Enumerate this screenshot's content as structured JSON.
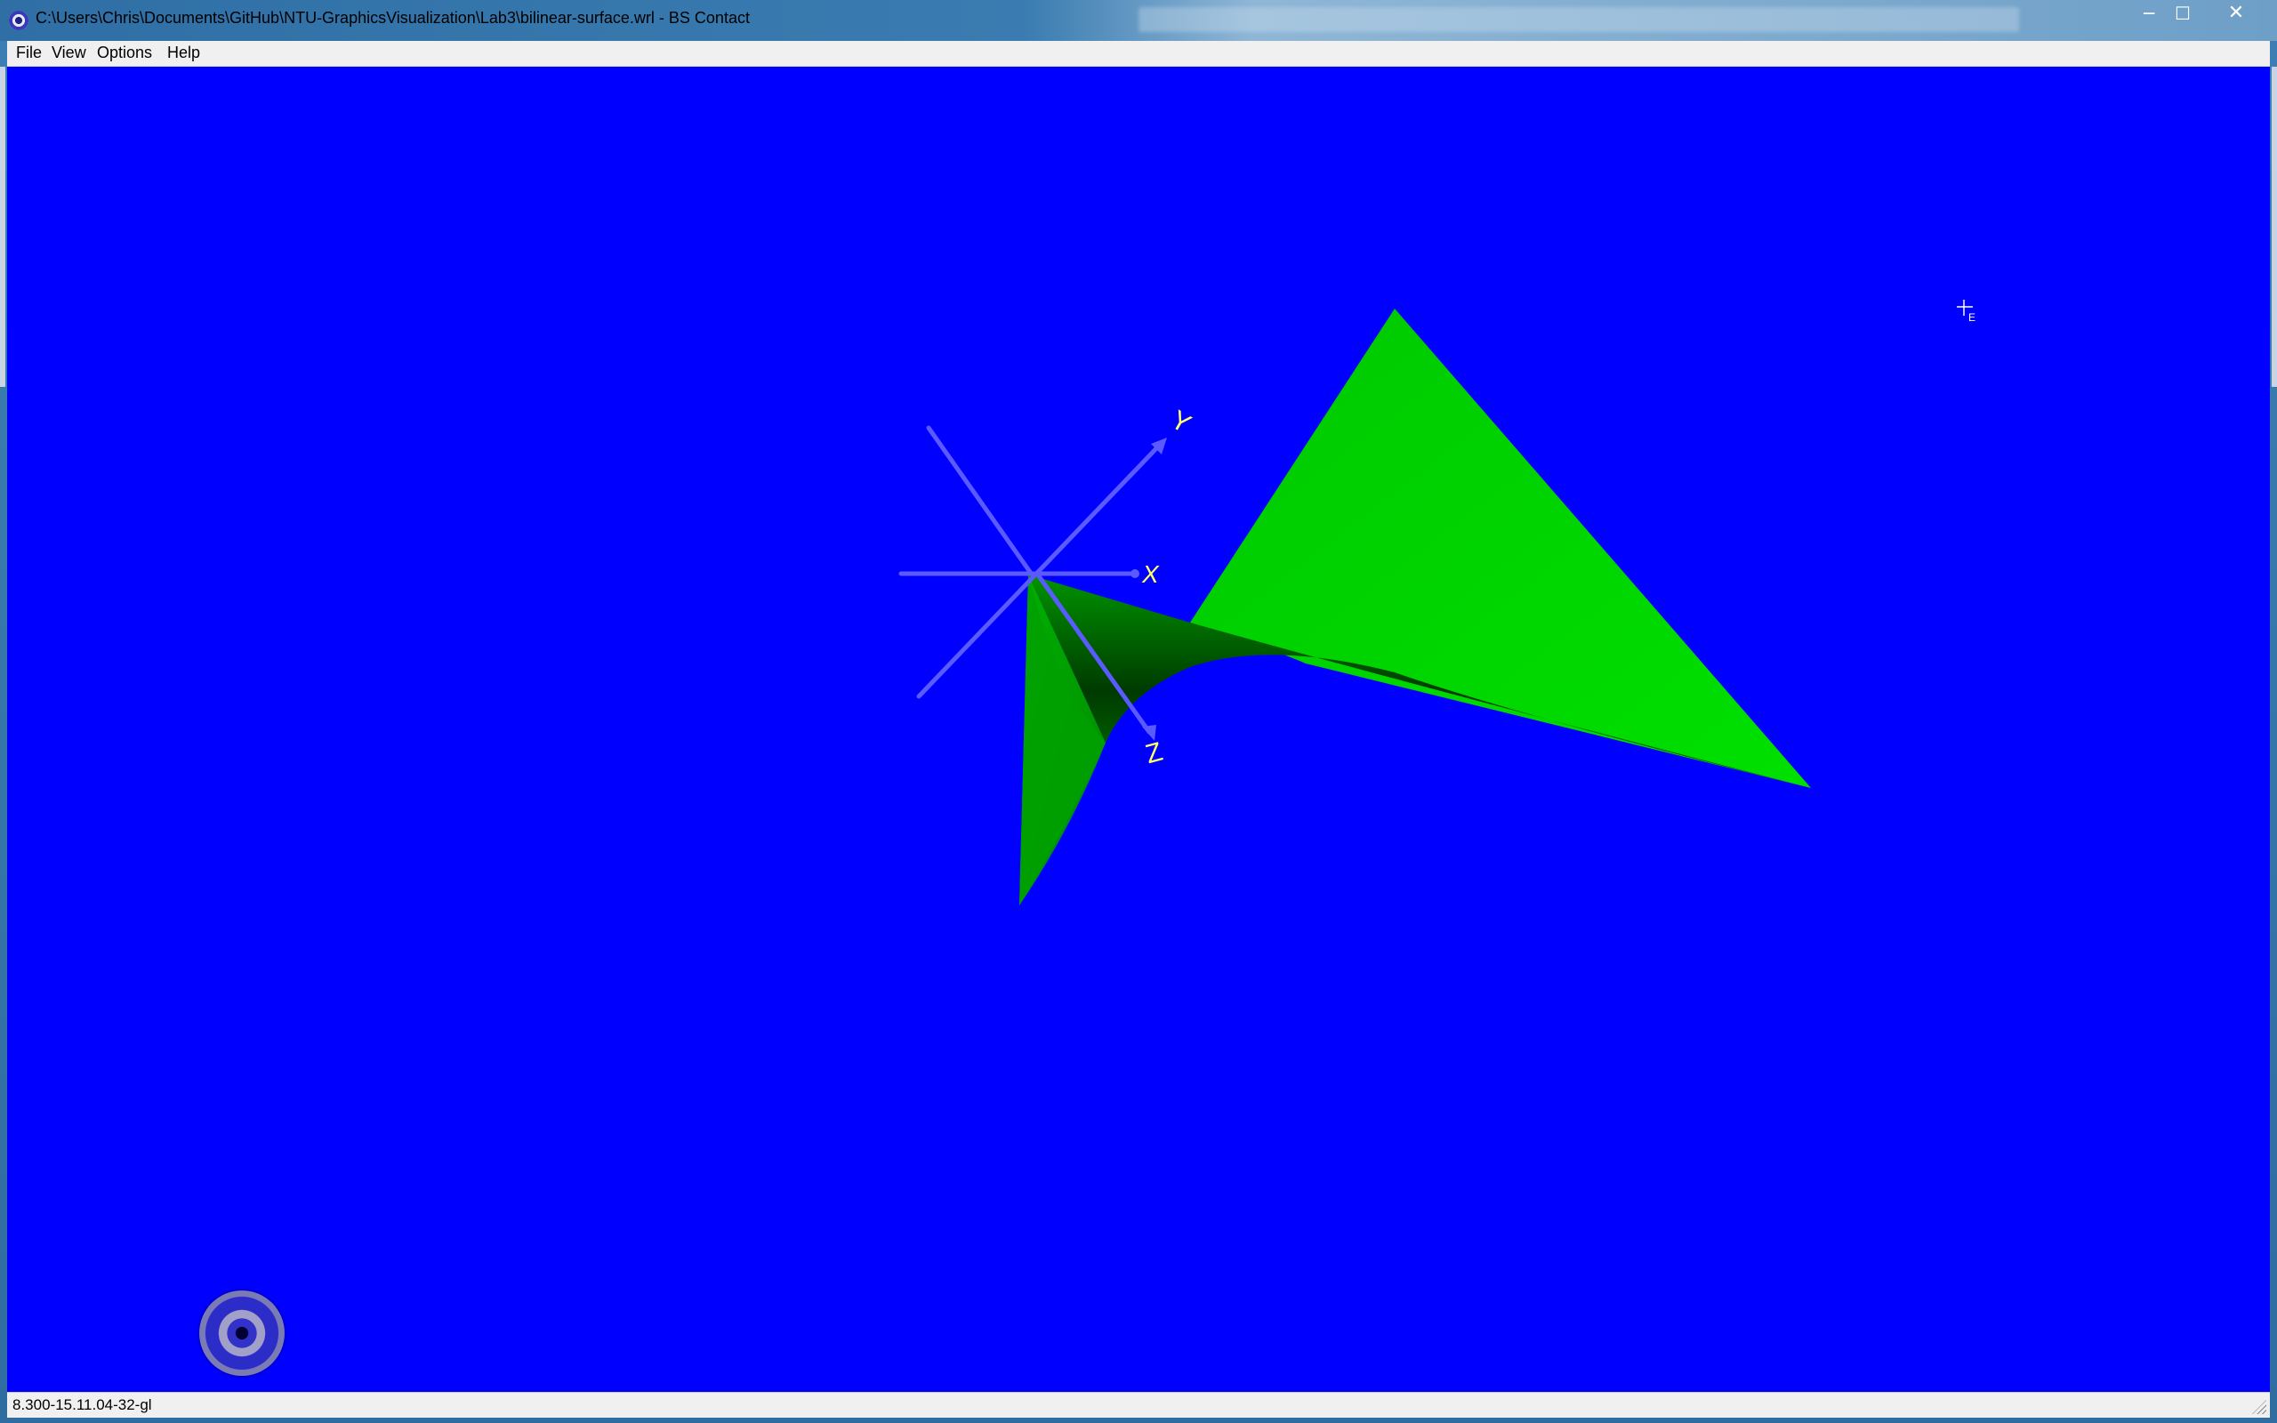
{
  "window": {
    "title": "C:\\Users\\Chris\\Documents\\GitHub\\NTU-GraphicsVisualization\\Lab3\\bilinear-surface.wrl - BS Contact",
    "minimize_glyph": "─",
    "maximize_glyph": "☐",
    "close_glyph": "✕"
  },
  "menu": {
    "items": [
      "File",
      "View",
      "Options",
      "Help"
    ]
  },
  "viewport": {
    "background_color": "#0000fe",
    "surface_color": "#00dd00",
    "axis_color": "#5a5aff",
    "axis_label_color": "#ffff66",
    "axis_labels": {
      "x": "X",
      "y": "Y",
      "z": "Z"
    },
    "cursor_label": "E"
  },
  "status": {
    "text": "8.300-15.11.04-32-gl"
  }
}
